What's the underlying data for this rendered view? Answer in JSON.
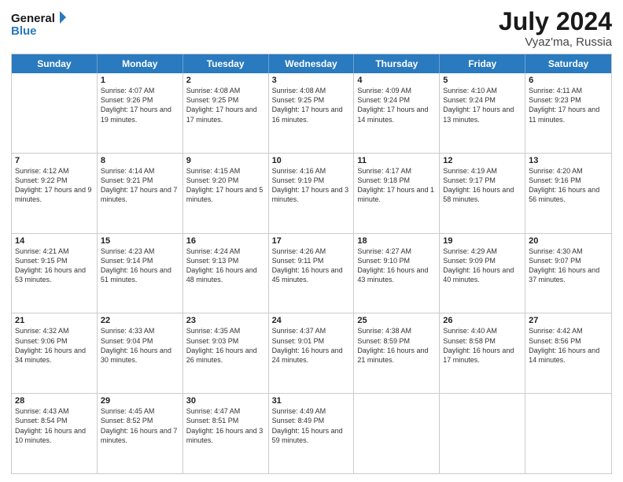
{
  "header": {
    "logo_line1": "General",
    "logo_line2": "Blue",
    "month": "July 2024",
    "location": "Vyaz'ma, Russia"
  },
  "days_of_week": [
    "Sunday",
    "Monday",
    "Tuesday",
    "Wednesday",
    "Thursday",
    "Friday",
    "Saturday"
  ],
  "weeks": [
    [
      {
        "day": "",
        "info": ""
      },
      {
        "day": "1",
        "info": "Sunrise: 4:07 AM\nSunset: 9:26 PM\nDaylight: 17 hours\nand 19 minutes."
      },
      {
        "day": "2",
        "info": "Sunrise: 4:08 AM\nSunset: 9:25 PM\nDaylight: 17 hours\nand 17 minutes."
      },
      {
        "day": "3",
        "info": "Sunrise: 4:08 AM\nSunset: 9:25 PM\nDaylight: 17 hours\nand 16 minutes."
      },
      {
        "day": "4",
        "info": "Sunrise: 4:09 AM\nSunset: 9:24 PM\nDaylight: 17 hours\nand 14 minutes."
      },
      {
        "day": "5",
        "info": "Sunrise: 4:10 AM\nSunset: 9:24 PM\nDaylight: 17 hours\nand 13 minutes."
      },
      {
        "day": "6",
        "info": "Sunrise: 4:11 AM\nSunset: 9:23 PM\nDaylight: 17 hours\nand 11 minutes."
      }
    ],
    [
      {
        "day": "7",
        "info": "Sunrise: 4:12 AM\nSunset: 9:22 PM\nDaylight: 17 hours\nand 9 minutes."
      },
      {
        "day": "8",
        "info": "Sunrise: 4:14 AM\nSunset: 9:21 PM\nDaylight: 17 hours\nand 7 minutes."
      },
      {
        "day": "9",
        "info": "Sunrise: 4:15 AM\nSunset: 9:20 PM\nDaylight: 17 hours\nand 5 minutes."
      },
      {
        "day": "10",
        "info": "Sunrise: 4:16 AM\nSunset: 9:19 PM\nDaylight: 17 hours\nand 3 minutes."
      },
      {
        "day": "11",
        "info": "Sunrise: 4:17 AM\nSunset: 9:18 PM\nDaylight: 17 hours\nand 1 minute."
      },
      {
        "day": "12",
        "info": "Sunrise: 4:19 AM\nSunset: 9:17 PM\nDaylight: 16 hours\nand 58 minutes."
      },
      {
        "day": "13",
        "info": "Sunrise: 4:20 AM\nSunset: 9:16 PM\nDaylight: 16 hours\nand 56 minutes."
      }
    ],
    [
      {
        "day": "14",
        "info": "Sunrise: 4:21 AM\nSunset: 9:15 PM\nDaylight: 16 hours\nand 53 minutes."
      },
      {
        "day": "15",
        "info": "Sunrise: 4:23 AM\nSunset: 9:14 PM\nDaylight: 16 hours\nand 51 minutes."
      },
      {
        "day": "16",
        "info": "Sunrise: 4:24 AM\nSunset: 9:13 PM\nDaylight: 16 hours\nand 48 minutes."
      },
      {
        "day": "17",
        "info": "Sunrise: 4:26 AM\nSunset: 9:11 PM\nDaylight: 16 hours\nand 45 minutes."
      },
      {
        "day": "18",
        "info": "Sunrise: 4:27 AM\nSunset: 9:10 PM\nDaylight: 16 hours\nand 43 minutes."
      },
      {
        "day": "19",
        "info": "Sunrise: 4:29 AM\nSunset: 9:09 PM\nDaylight: 16 hours\nand 40 minutes."
      },
      {
        "day": "20",
        "info": "Sunrise: 4:30 AM\nSunset: 9:07 PM\nDaylight: 16 hours\nand 37 minutes."
      }
    ],
    [
      {
        "day": "21",
        "info": "Sunrise: 4:32 AM\nSunset: 9:06 PM\nDaylight: 16 hours\nand 34 minutes."
      },
      {
        "day": "22",
        "info": "Sunrise: 4:33 AM\nSunset: 9:04 PM\nDaylight: 16 hours\nand 30 minutes."
      },
      {
        "day": "23",
        "info": "Sunrise: 4:35 AM\nSunset: 9:03 PM\nDaylight: 16 hours\nand 26 minutes."
      },
      {
        "day": "24",
        "info": "Sunrise: 4:37 AM\nSunset: 9:01 PM\nDaylight: 16 hours\nand 24 minutes."
      },
      {
        "day": "25",
        "info": "Sunrise: 4:38 AM\nSunset: 8:59 PM\nDaylight: 16 hours\nand 21 minutes."
      },
      {
        "day": "26",
        "info": "Sunrise: 4:40 AM\nSunset: 8:58 PM\nDaylight: 16 hours\nand 17 minutes."
      },
      {
        "day": "27",
        "info": "Sunrise: 4:42 AM\nSunset: 8:56 PM\nDaylight: 16 hours\nand 14 minutes."
      }
    ],
    [
      {
        "day": "28",
        "info": "Sunrise: 4:43 AM\nSunset: 8:54 PM\nDaylight: 16 hours\nand 10 minutes."
      },
      {
        "day": "29",
        "info": "Sunrise: 4:45 AM\nSunset: 8:52 PM\nDaylight: 16 hours\nand 7 minutes."
      },
      {
        "day": "30",
        "info": "Sunrise: 4:47 AM\nSunset: 8:51 PM\nDaylight: 16 hours\nand 3 minutes."
      },
      {
        "day": "31",
        "info": "Sunrise: 4:49 AM\nSunset: 8:49 PM\nDaylight: 15 hours\nand 59 minutes."
      },
      {
        "day": "",
        "info": ""
      },
      {
        "day": "",
        "info": ""
      },
      {
        "day": "",
        "info": ""
      }
    ]
  ]
}
